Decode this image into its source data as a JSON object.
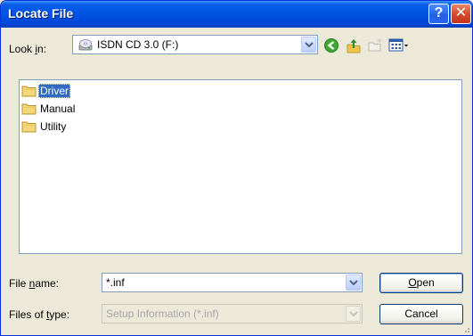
{
  "window": {
    "title": "Locate File"
  },
  "titlebar": {
    "help_glyph": "?",
    "close_glyph": "✕"
  },
  "look_in": {
    "label_pre": "Look ",
    "label_accel": "i",
    "label_post": "n:",
    "value": "ISDN CD 3.0 (F:)",
    "icon": "cd-drive-icon"
  },
  "toolbar": {
    "back_icon": "back-arrow-icon",
    "up_icon": "up-one-level-icon",
    "new_folder_icon": "new-folder-icon",
    "views_icon": "views-menu-icon"
  },
  "files": [
    {
      "name": "Driver",
      "type": "folder",
      "selected": true
    },
    {
      "name": "Manual",
      "type": "folder",
      "selected": false
    },
    {
      "name": "Utility",
      "type": "folder",
      "selected": false
    }
  ],
  "file_name": {
    "label_pre": "File ",
    "label_accel": "n",
    "label_post": "ame:",
    "value": "*.inf"
  },
  "file_type": {
    "label_pre": "Files of ",
    "label_accel": "t",
    "label_post": "ype:",
    "value": "Setup Information (*.inf)",
    "enabled": false
  },
  "buttons": {
    "open_accel": "O",
    "open_rest": "pen",
    "cancel": "Cancel"
  },
  "colors": {
    "titlebar": "#0055e5",
    "selection": "#316ac5",
    "folder": "#f5d77a",
    "dialog_bg": "#ece9d8"
  }
}
